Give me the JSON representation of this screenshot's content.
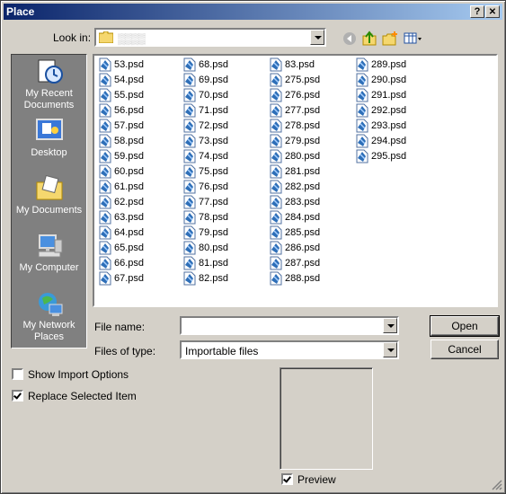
{
  "window": {
    "title": "Place",
    "help_label": "?",
    "close_label": "✕"
  },
  "look_in": {
    "label": "Look in:",
    "value": "▒▒▒▒"
  },
  "places": [
    {
      "label": "My Recent Documents",
      "icon": "recent-documents-icon"
    },
    {
      "label": "Desktop",
      "icon": "desktop-icon"
    },
    {
      "label": "My Documents",
      "icon": "my-documents-icon"
    },
    {
      "label": "My Computer",
      "icon": "my-computer-icon"
    },
    {
      "label": "My Network Places",
      "icon": "network-places-icon"
    }
  ],
  "files": {
    "col1": [
      "53.psd",
      "54.psd",
      "55.psd",
      "56.psd",
      "57.psd",
      "58.psd",
      "59.psd",
      "60.psd",
      "61.psd",
      "62.psd",
      "63.psd",
      "64.psd",
      "65.psd",
      "66.psd",
      "67.psd"
    ],
    "col2": [
      "68.psd",
      "69.psd",
      "70.psd",
      "71.psd",
      "72.psd",
      "73.psd",
      "74.psd",
      "75.psd",
      "76.psd",
      "77.psd",
      "78.psd",
      "79.psd",
      "80.psd",
      "81.psd",
      "82.psd"
    ],
    "col3": [
      "83.psd",
      "275.psd",
      "276.psd",
      "277.psd",
      "278.psd",
      "279.psd",
      "280.psd",
      "281.psd",
      "282.psd",
      "283.psd",
      "284.psd",
      "285.psd",
      "286.psd",
      "287.psd",
      "288.psd"
    ],
    "col4": [
      "289.psd",
      "290.psd",
      "291.psd",
      "292.psd",
      "293.psd",
      "294.psd",
      "295.psd"
    ]
  },
  "file_name": {
    "label": "File name:",
    "value": ""
  },
  "file_type": {
    "label": "Files of type:",
    "value": "Importable files"
  },
  "buttons": {
    "open": "Open",
    "cancel": "Cancel"
  },
  "options": {
    "show_import": {
      "label": "Show Import Options",
      "checked": false
    },
    "replace_selected": {
      "label": "Replace Selected Item",
      "checked": true
    },
    "preview": {
      "label": "Preview",
      "checked": true
    }
  },
  "colors": {
    "title_bar_start": "#0a246a",
    "title_bar_end": "#a6caf0",
    "places_bar": "#808080",
    "face": "#d4d0c8"
  }
}
